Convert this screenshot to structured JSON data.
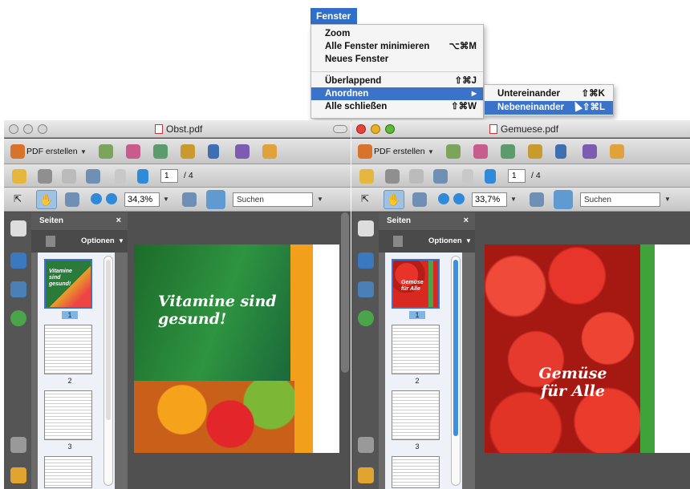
{
  "menu": {
    "title": "Fenster",
    "items": [
      {
        "label": "Zoom",
        "shortcut": ""
      },
      {
        "label": "Alle Fenster minimieren",
        "shortcut": "⌥⌘M"
      },
      {
        "label": "Neues Fenster",
        "shortcut": ""
      },
      {
        "label": "Überlappend",
        "shortcut": "⇧⌘J"
      },
      {
        "label": "Anordnen",
        "shortcut": "▶"
      },
      {
        "label": "Alle schließen",
        "shortcut": "⇧⌘W"
      }
    ],
    "submenu": [
      {
        "label": "Untereinander",
        "shortcut": "⇧⌘K"
      },
      {
        "label": "Nebeneinander",
        "shortcut": "⇧⌘L"
      }
    ]
  },
  "left_window": {
    "title": "Obst.pdf",
    "toolbar": {
      "create_pdf": "PDF erstellen",
      "page_current": "1",
      "page_total": "/ 4",
      "zoom": "34,3%",
      "search": "Suchen"
    },
    "panel": {
      "title": "Seiten",
      "close": "×",
      "options": "Optionen"
    },
    "thumb_numbers": [
      "1",
      "2",
      "3"
    ],
    "page_headline": "Vitamine sind gesund!",
    "thumb_text": "Vitamine sind gesund!"
  },
  "right_window": {
    "title": "Gemuese.pdf",
    "toolbar": {
      "create_pdf": "PDF erstellen",
      "page_current": "1",
      "page_total": "/ 4",
      "zoom": "33,7%",
      "search": "Suchen"
    },
    "panel": {
      "title": "Seiten",
      "close": "×",
      "options": "Optionen"
    },
    "thumb_numbers": [
      "1",
      "2",
      "3"
    ],
    "page_headline": "Gemüse für Alle",
    "thumb_text": "Gemüse für Alle"
  },
  "colors": {
    "menu_highlight": "#3a73c9",
    "panel_dark": "#4d4d4d",
    "selection_blue": "#7fb5e4"
  }
}
